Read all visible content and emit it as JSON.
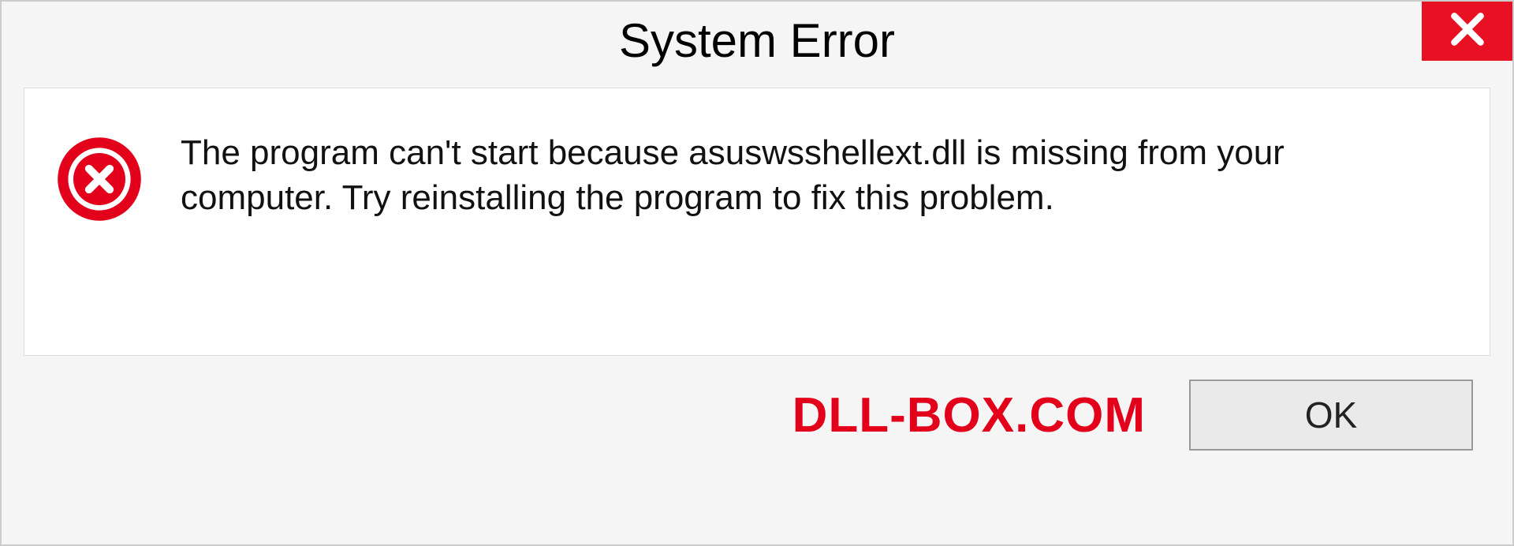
{
  "dialog": {
    "title": "System Error",
    "message": "The program can't start because asuswsshellext.dll is missing from your computer. Try reinstalling the program to fix this problem.",
    "ok_label": "OK"
  },
  "brand": "DLL-BOX.COM",
  "colors": {
    "close_bg": "#e81123",
    "brand_color": "#e2001a"
  },
  "icons": {
    "close": "close-icon",
    "error": "error-icon"
  }
}
